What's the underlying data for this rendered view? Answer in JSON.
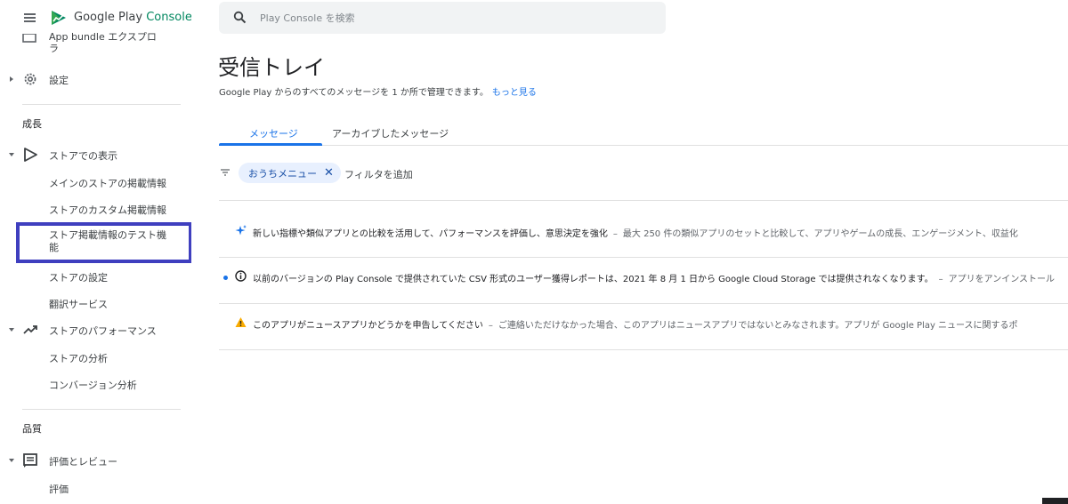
{
  "brand": {
    "name": "Google Play",
    "suffix": "Console"
  },
  "search": {
    "placeholder": "Play Console を検索"
  },
  "sidebar": {
    "partial_item": {
      "line1": "App bundle エクスプロ",
      "line2": "ラ"
    },
    "settings_item": "設定",
    "section_growth": "成長",
    "store_presence": "ストアでの表示",
    "store_presence_children": [
      "メインのストアの掲載情報",
      "ストアのカスタム掲載情報",
      "ストア掲載情報のテスト機",
      "能",
      "ストアの設定",
      "翻訳サービス"
    ],
    "store_performance": "ストアのパフォーマンス",
    "store_performance_children": [
      "ストアの分析",
      "コンバージョン分析"
    ],
    "section_quality": "品質",
    "ratings_reviews": "評価とレビュー",
    "ratings_children": [
      "評価"
    ]
  },
  "page": {
    "title": "受信トレイ",
    "description": "Google Play からのすべてのメッセージを 1 か所で管理できます。",
    "learn_more": "もっと見る"
  },
  "tabs": [
    {
      "label": "メッセージ",
      "active": true
    },
    {
      "label": "アーカイブしたメッセージ",
      "active": false
    }
  ],
  "filter": {
    "chip": "おうちメニュー",
    "chip_close": "✕",
    "add": "フィルタを追加"
  },
  "messages": [
    {
      "icon": "sparkle-icon",
      "title": "新しい指標や類似アプリとの比較を活用して、パフォーマンスを評価し、意思決定を強化",
      "separator": "–",
      "body": "最大 250 件の類似アプリのセットと比較して、アプリやゲームの成長、エンゲージメント、収益化",
      "unread": false
    },
    {
      "icon": "info-icon",
      "title": "以前のバージョンの Play Console で提供されていた CSV 形式のユーザー獲得レポートは、2021 年 8 月 1 日から Google Cloud Storage では提供されなくなります。",
      "separator": "–",
      "body": "アプリをアンインストール",
      "unread": true
    },
    {
      "icon": "warning-icon",
      "title": "このアプリがニュースアプリかどうかを申告してください",
      "separator": "–",
      "body": "ご連絡いただけなかった場合、このアプリはニュースアプリではないとみなされます。アプリが Google Play ニュースに関するポ",
      "unread": false
    }
  ],
  "colors": {
    "accent": "#1a73e8",
    "highlight": "#3f3fbf",
    "warning": "#f9ab00",
    "brand": "#01875f"
  }
}
